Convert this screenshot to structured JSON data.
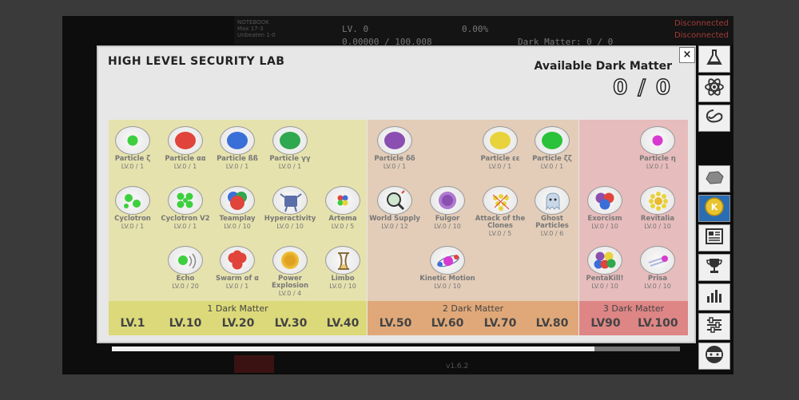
{
  "hud": {
    "mini_lines": [
      "NOTEBOOK",
      "Max 17-3",
      "Unbeaten 1-0"
    ],
    "level": "LV. 0",
    "percent": "0.00%",
    "xp": "0.00000 / 100.008",
    "dark_matter": "Dark Matter: 0 / 0",
    "status1": "Disconnected",
    "status2": "Disconnected",
    "version": "v1.6.2"
  },
  "lab": {
    "title": "HIGH LEVEL SECURITY LAB",
    "close": "×",
    "available_label": "Available Dark Matter",
    "available_value": "0 / 0"
  },
  "tiers": [
    {
      "cost": "1 Dark Matter",
      "levels": [
        "LV.1",
        "LV.10",
        "LV.20",
        "LV.30",
        "LV.40"
      ]
    },
    {
      "cost": "2 Dark Matter",
      "levels": [
        "LV.50",
        "LV.60",
        "LV.70",
        "LV.80"
      ]
    },
    {
      "cost": "3 Dark Matter",
      "levels": [
        "LV90",
        "LV.100"
      ]
    }
  ],
  "items": [
    {
      "name": "Particle ζ",
      "level": "LV.0 / 1"
    },
    {
      "name": "Particle αα",
      "level": "LV.0 / 1"
    },
    {
      "name": "Particle ßß",
      "level": "LV.0 / 1"
    },
    {
      "name": "Particle γγ",
      "level": "LV.0 / 1"
    },
    {
      "name": "Cyclotron",
      "level": "LV.0 / 1"
    },
    {
      "name": "Cyclotron V2",
      "level": "LV.0 / 1"
    },
    {
      "name": "Teamplay",
      "level": "LV.0 / 10"
    },
    {
      "name": "Hyperactivity",
      "level": "LV.0 / 10"
    },
    {
      "name": "Artema",
      "level": "LV.0 / 5"
    },
    {
      "name": "Echo",
      "level": "LV.0 / 20"
    },
    {
      "name": "Swarm of α",
      "level": "LV.0 / 1"
    },
    {
      "name": "Power Explosion",
      "level": "LV.0 / 4"
    },
    {
      "name": "Limbo",
      "level": "LV.0 / 10"
    },
    {
      "name": "Particle δδ",
      "level": "LV.0 / 1"
    },
    {
      "name": "Particle εε",
      "level": "LV.0 / 1"
    },
    {
      "name": "Particle ζζ",
      "level": "LV.0 / 1"
    },
    {
      "name": "World Supply",
      "level": "LV.0 / 12"
    },
    {
      "name": "Fulgor",
      "level": "LV.0 / 10"
    },
    {
      "name": "Attack of the Clones",
      "level": "LV.0 / 5"
    },
    {
      "name": "Ghost Particles",
      "level": "LV.0 / 6"
    },
    {
      "name": "Kinetic Motion",
      "level": "LV.0 / 10"
    },
    {
      "name": "Particle η",
      "level": "LV.0 / 1"
    },
    {
      "name": "Exorcism",
      "level": "LV.0 / 10"
    },
    {
      "name": "Revitalia",
      "level": "LV.0 / 10"
    },
    {
      "name": "PentaKill!",
      "level": "LV.0 / 10"
    },
    {
      "name": "Prisa",
      "level": "LV.0 / 10"
    }
  ],
  "colors": {
    "tier1": "#e6e2ad",
    "tier2": "#e3cdb8",
    "tier3": "#e7bcbc",
    "particle_zeta": "#3ecf3e",
    "particle_alpha": "#e0443a",
    "particle_beta": "#3a6fd8",
    "particle_gamma": "#2fa84f",
    "particle_delta": "#8a4fb0",
    "particle_epsilon": "#e8d33c",
    "particle_zetazeta": "#29c23a",
    "particle_eta": "#d83ad0",
    "sidebar_active": "#2b6db3"
  },
  "sidebar": [
    "flask-icon",
    "atom-icon",
    "galaxy-icon",
    "rock-icon",
    "coin-icon",
    "news-icon",
    "trophy-icon",
    "stats-icon",
    "settings-icon",
    "ninja-icon"
  ],
  "progress_fraction": 0.85
}
